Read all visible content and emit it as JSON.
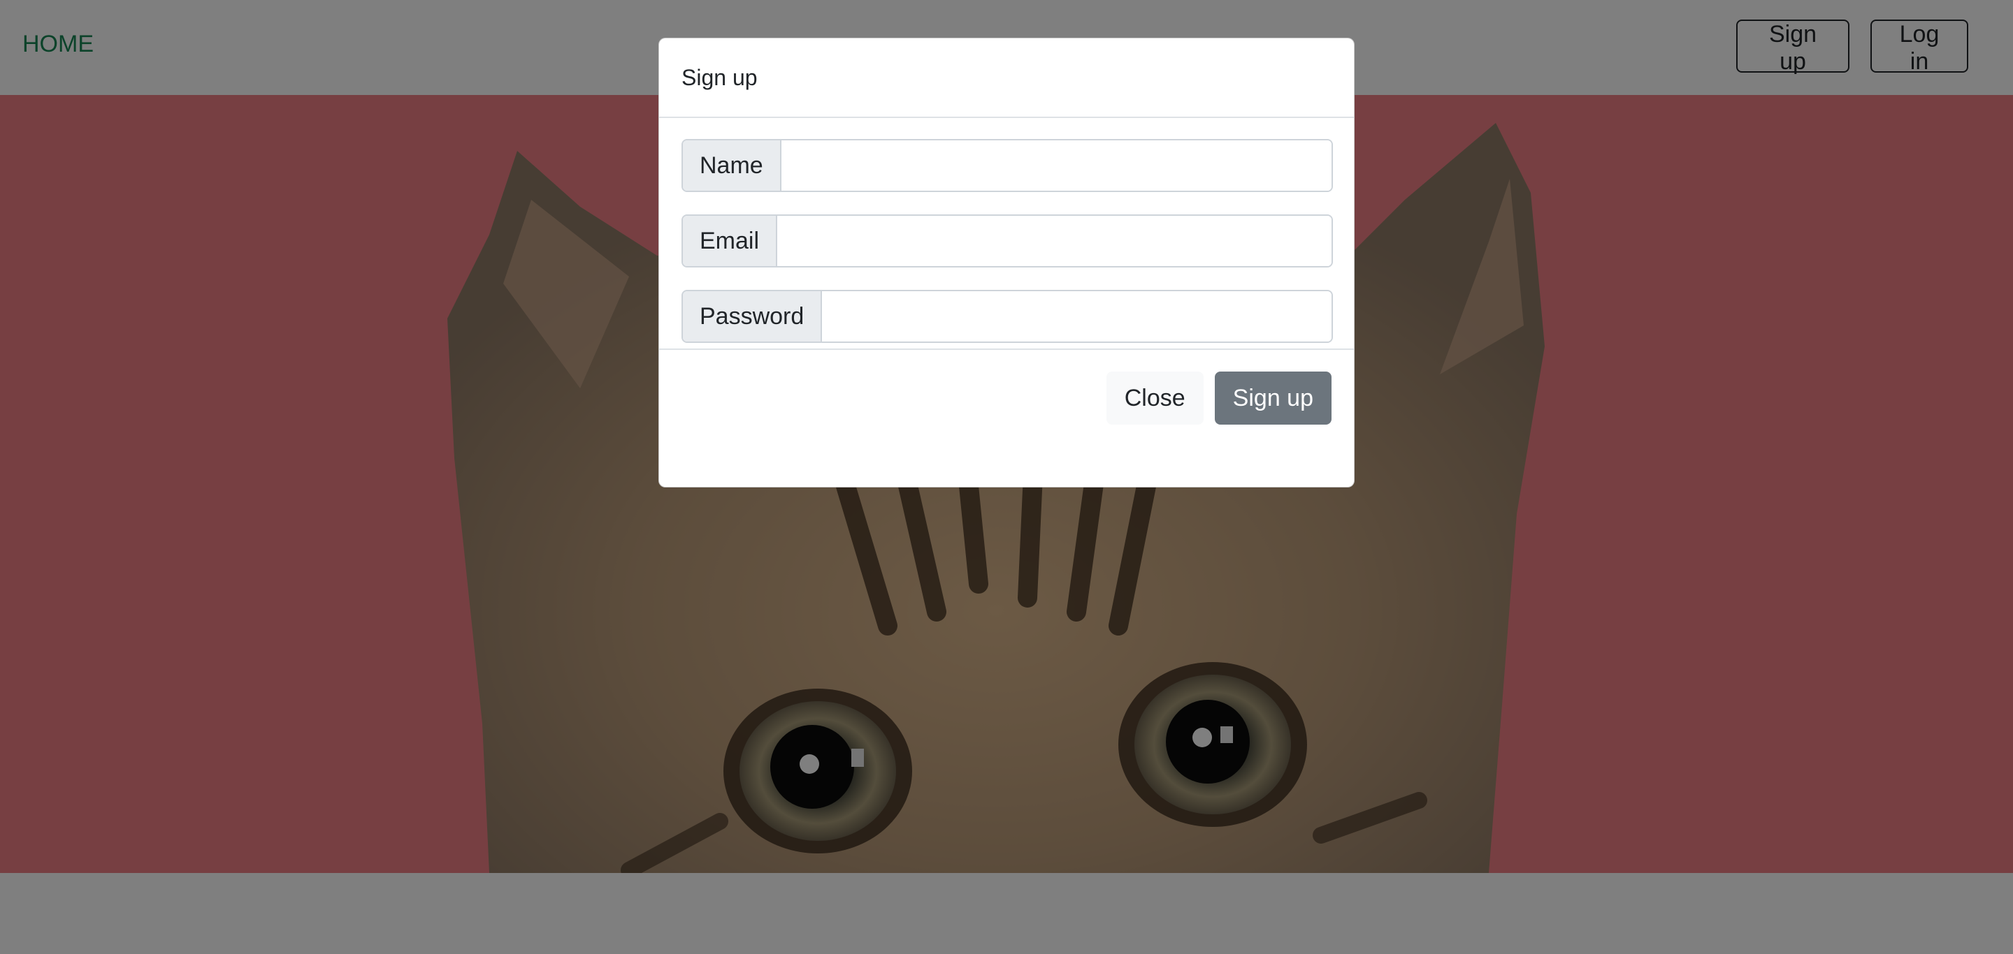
{
  "navbar": {
    "home_label": "HOME",
    "signup_label": "Sign up",
    "login_label": "Log in"
  },
  "hero": {
    "image": "kitten-peeking-face",
    "background_color": "#ef7f85"
  },
  "modal": {
    "title": "Sign up",
    "fields": [
      {
        "label": "Name",
        "value": ""
      },
      {
        "label": "Email",
        "value": ""
      },
      {
        "label": "Password",
        "value": ""
      }
    ],
    "close_label": "Close",
    "submit_label": "Sign up"
  },
  "colors": {
    "home_link": "#198754",
    "backdrop": "rgba(0,0,0,0.5)",
    "submit_button": "#6c757d"
  }
}
